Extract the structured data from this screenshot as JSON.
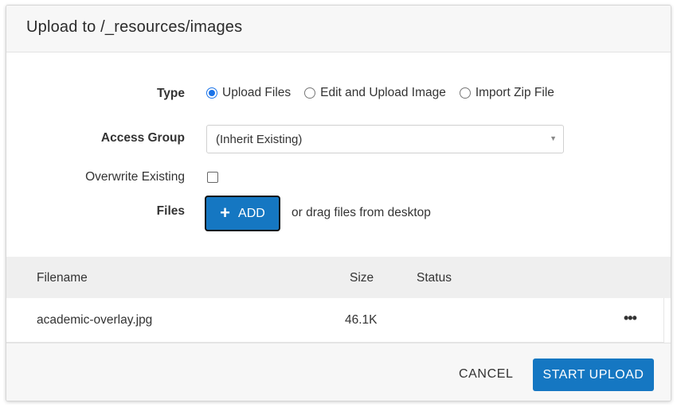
{
  "dialog": {
    "title": "Upload to /_resources/images"
  },
  "form": {
    "type_label": "Type",
    "type_options": [
      "Upload Files",
      "Edit and Upload Image",
      "Import Zip File"
    ],
    "type_selected": "Upload Files",
    "access_group_label": "Access Group",
    "access_group_value": "(Inherit Existing)",
    "overwrite_label": "Overwrite Existing",
    "overwrite_checked": false,
    "files_label": "Files",
    "add_button_label": "ADD",
    "drag_hint": "or drag files from desktop"
  },
  "table": {
    "columns": [
      "Filename",
      "Size",
      "Status"
    ],
    "rows": [
      {
        "filename": "academic-overlay.jpg",
        "size": "46.1K",
        "status": ""
      }
    ]
  },
  "footer": {
    "cancel_label": "CANCEL",
    "start_upload_label": "START UPLOAD"
  },
  "icons": {
    "add": "plus-icon",
    "select": "caret-down-icon",
    "row_menu": "more-horizontal-icon"
  },
  "colors": {
    "primary": "#1577c2",
    "radio_selected": "#1a73e8",
    "header_bg": "#f7f7f7",
    "table_head_bg": "#efefef"
  }
}
